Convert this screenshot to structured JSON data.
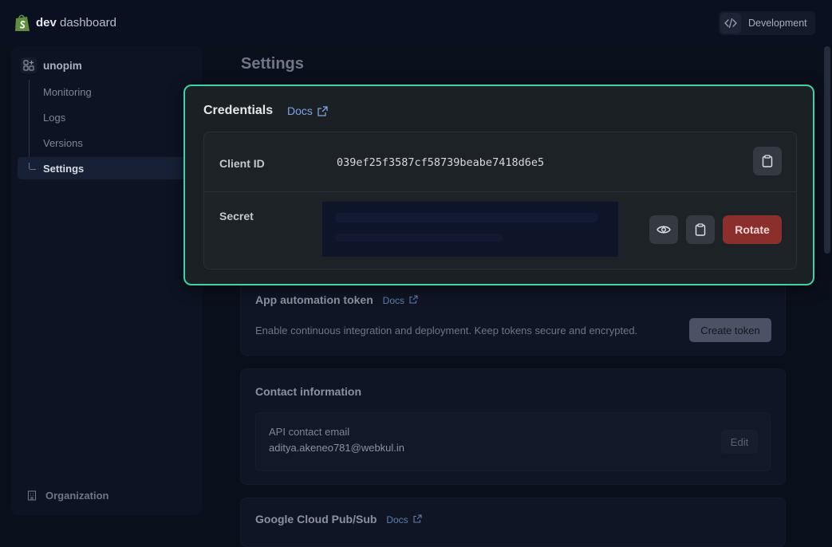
{
  "topbar": {
    "brand_bold": "dev",
    "brand_rest": "dashboard",
    "env_label": "Development",
    "icons": {
      "logo": "shopify-bag-icon",
      "env": "code-icon"
    }
  },
  "sidebar": {
    "app_name": "unopim",
    "items": [
      {
        "label": "Monitoring"
      },
      {
        "label": "Logs"
      },
      {
        "label": "Versions"
      },
      {
        "label": "Settings",
        "active": true
      }
    ],
    "org_label": "Organization"
  },
  "main": {
    "title": "Settings",
    "automation": {
      "title": "App automation token",
      "docs": "Docs",
      "description": "Enable continuous integration and deployment. Keep tokens secure and encrypted.",
      "button": "Create token"
    },
    "contact": {
      "title": "Contact information",
      "email_label": "API contact email",
      "email_value": "aditya.akeneo781@webkul.in",
      "edit_button": "Edit"
    },
    "pubsub": {
      "title": "Google Cloud Pub/Sub",
      "docs": "Docs"
    }
  },
  "credentials": {
    "title": "Credentials",
    "docs": "Docs",
    "client_id_label": "Client ID",
    "client_id_value": "039ef25f3587cf58739beabe7418d6e5",
    "secret_label": "Secret",
    "rotate_button": "Rotate",
    "colors": {
      "highlight": "#3dd3a8",
      "rotate": "#8a2f2c"
    }
  }
}
